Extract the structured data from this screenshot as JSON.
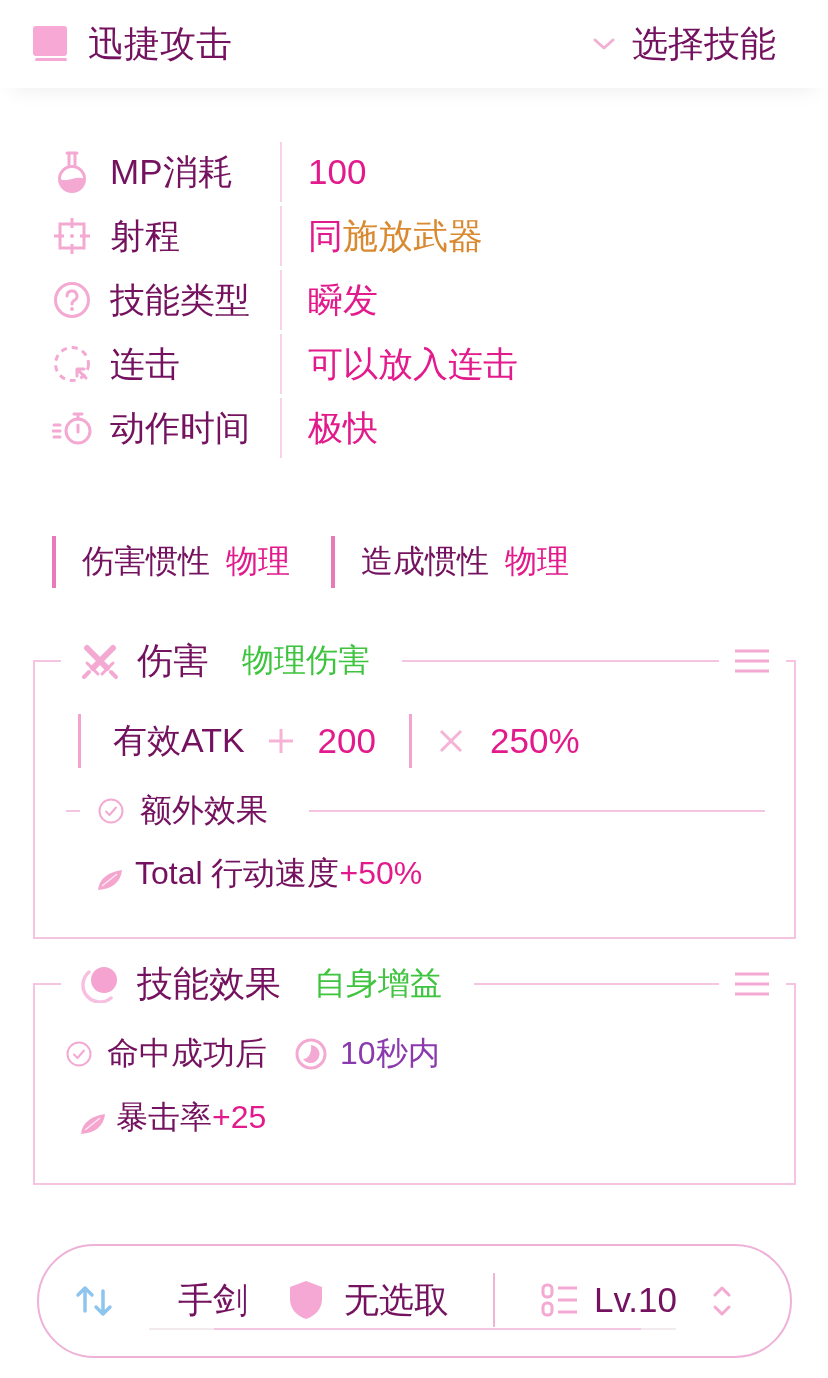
{
  "header": {
    "title": "迅捷攻击",
    "selector": "选择技能"
  },
  "properties": [
    {
      "label": "MP消耗",
      "value": "100"
    },
    {
      "label": "射程",
      "value": "同",
      "reference": "施放武器"
    },
    {
      "label": "技能类型",
      "value": "瞬发"
    },
    {
      "label": "连击",
      "value": "可以放入连击"
    },
    {
      "label": "动作时间",
      "value": "极快"
    }
  ],
  "inertia": [
    {
      "label": "伤害惯性",
      "value": "物理"
    },
    {
      "label": "造成惯性",
      "value": "物理"
    }
  ],
  "damage_card": {
    "title": "伤害",
    "category": "物理伤害",
    "formula": {
      "base": "有效ATK",
      "addend": "200",
      "multiplier": "250%"
    },
    "extra_title": "额外效果",
    "extra_effects": [
      {
        "stat": "Total 行动速度",
        "amount": "+50%"
      }
    ]
  },
  "effect_card": {
    "title": "技能效果",
    "category": "自身增益",
    "condition": "命中成功后",
    "duration": "10秒内",
    "effects": [
      {
        "stat": "暴击率",
        "amount": "+25"
      }
    ]
  },
  "footer": {
    "weapon": "手剑",
    "armor": "无选取",
    "level": "Lv.10"
  }
}
